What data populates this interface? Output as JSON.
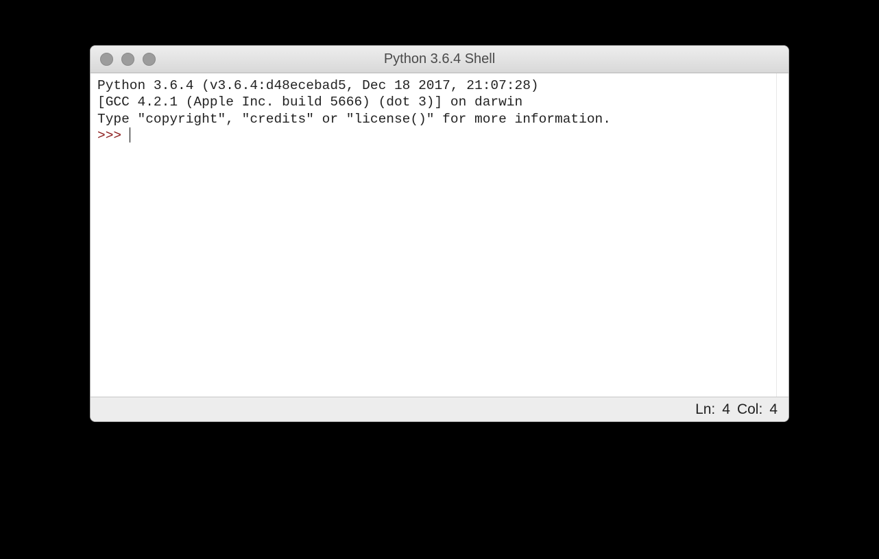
{
  "window": {
    "title": "Python 3.6.4 Shell"
  },
  "shell": {
    "line1": "Python 3.6.4 (v3.6.4:d48ecebad5, Dec 18 2017, 21:07:28) ",
    "line2": "[GCC 4.2.1 (Apple Inc. build 5666) (dot 3)] on darwin",
    "line3": "Type \"copyright\", \"credits\" or \"license()\" for more information.",
    "prompt": ">>> "
  },
  "status": {
    "line_label": "Ln: ",
    "line_value": "4",
    "col_label": "Col: ",
    "col_value": "4"
  }
}
